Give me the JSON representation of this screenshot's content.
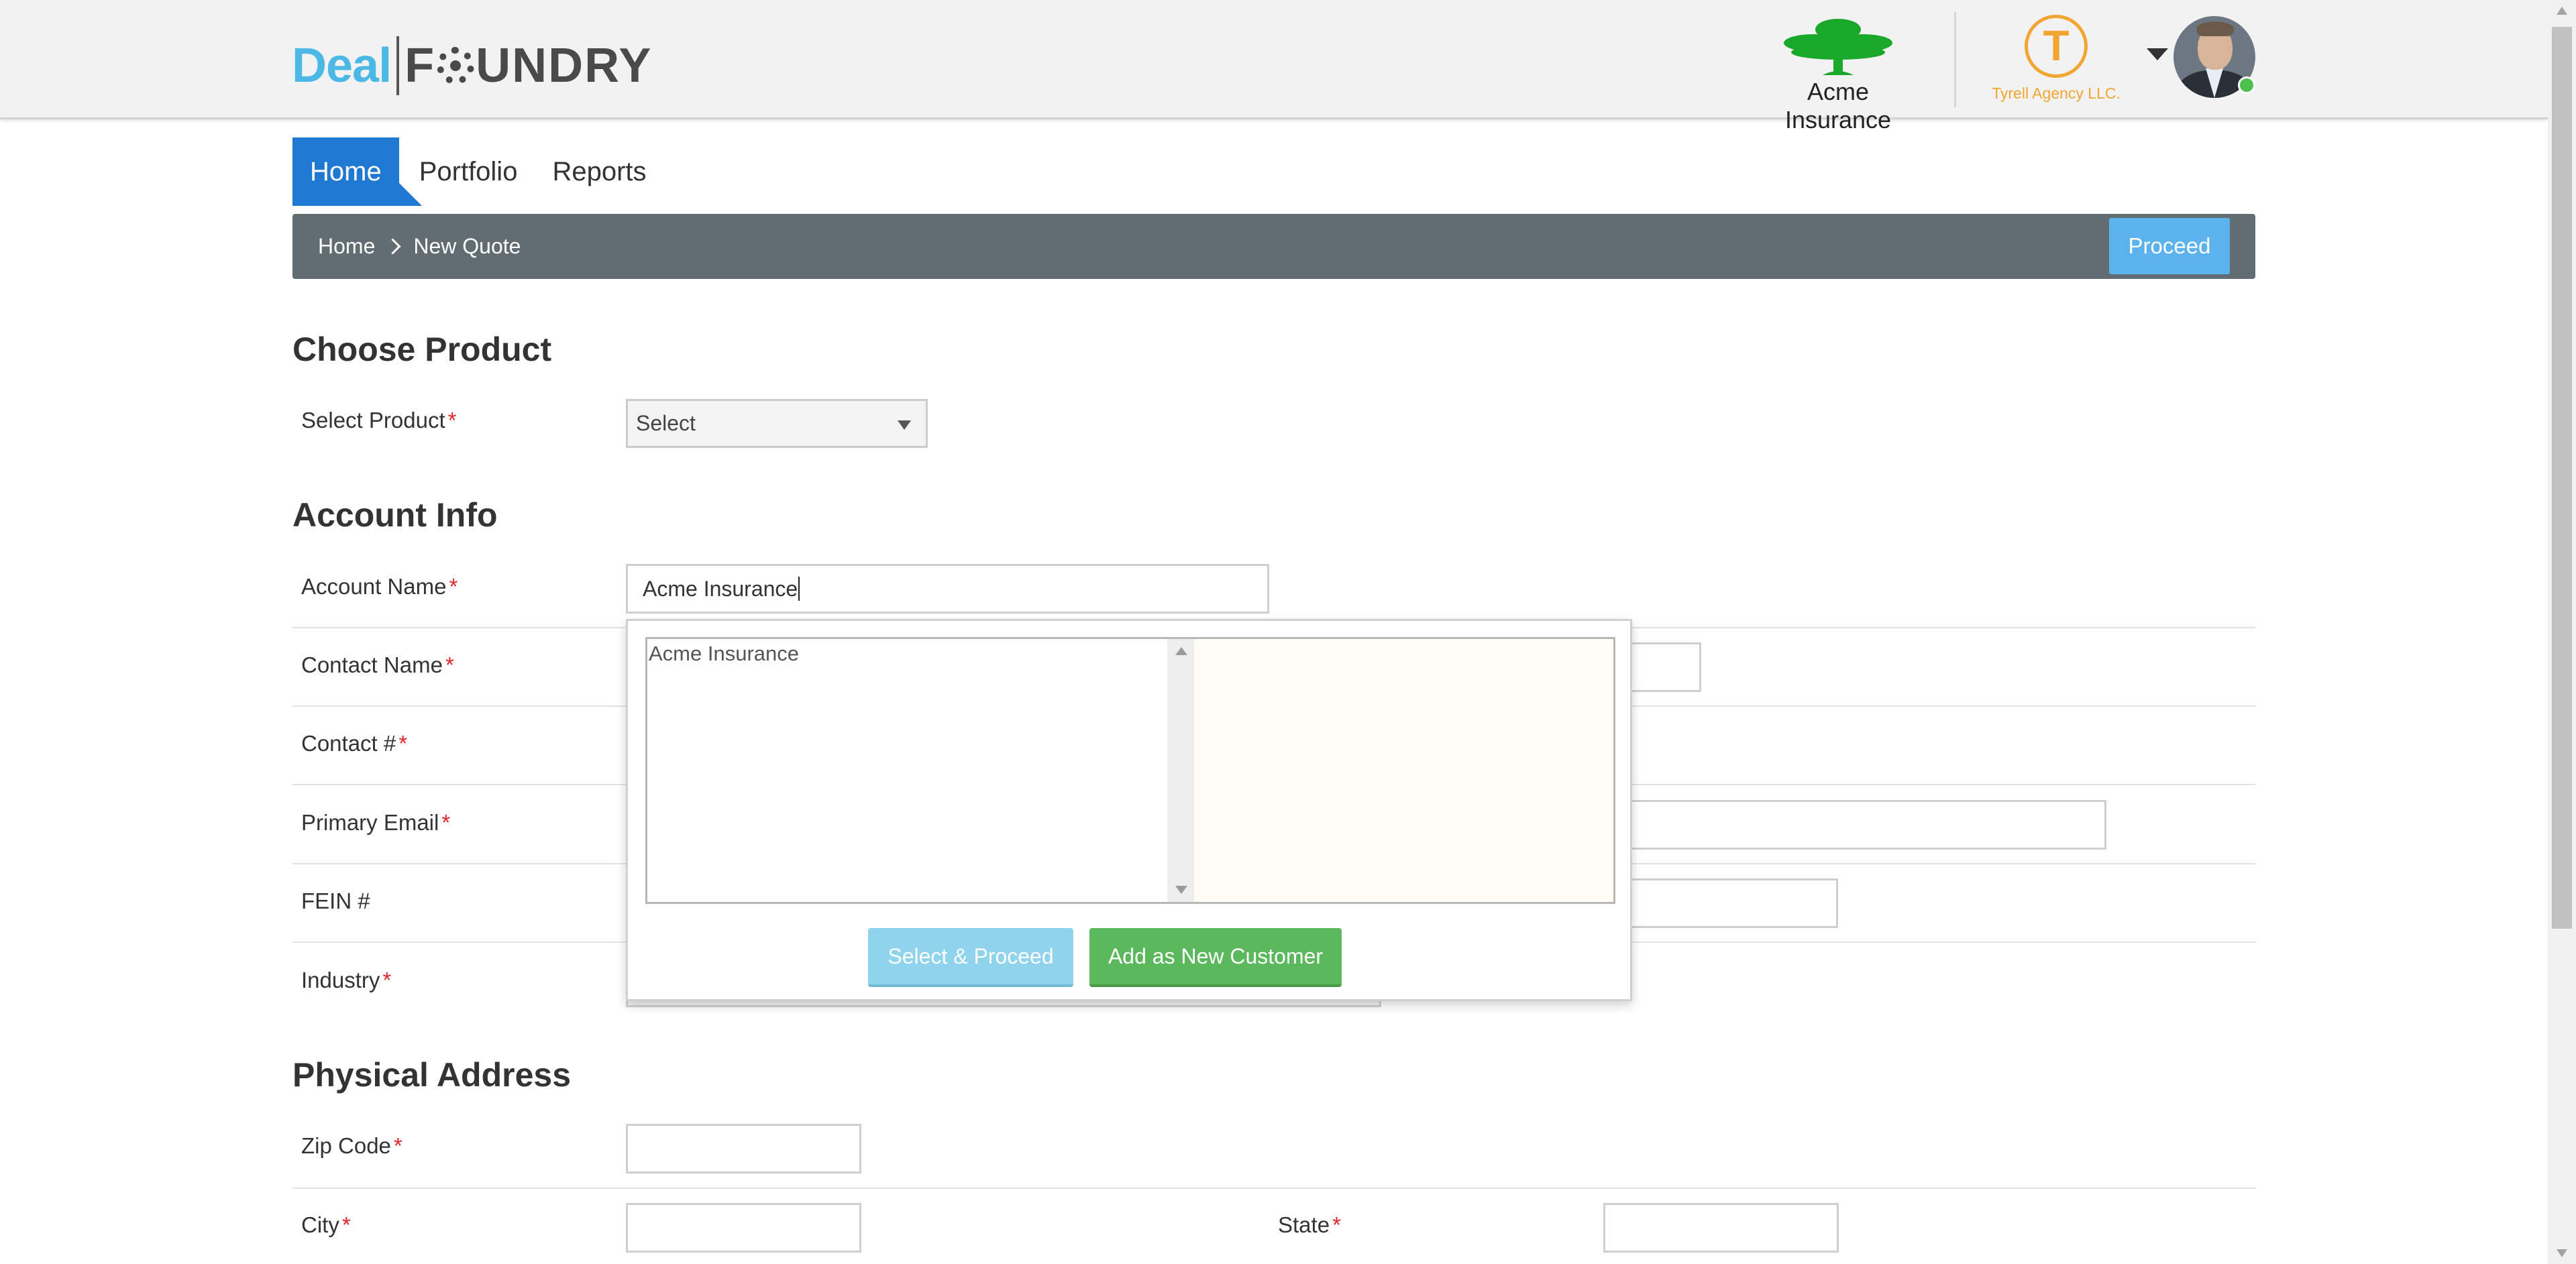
{
  "brand": {
    "logo_left": "Deal",
    "logo_right_prefix": "F",
    "logo_right_suffix": "UNDRY",
    "carrier_name": "Acme Insurance",
    "agency_name": "Tyrell Agency LLC.",
    "agency_initial": "T"
  },
  "nav": {
    "items": [
      {
        "label": "Home"
      },
      {
        "label": "Portfolio"
      },
      {
        "label": "Reports"
      }
    ]
  },
  "breadcrumb": {
    "items": [
      "Home",
      "New Quote"
    ],
    "proceed_label": "Proceed"
  },
  "choose_product": {
    "title": "Choose Product",
    "select_product_label": "Select Product",
    "select_product_value": "Select"
  },
  "account_info": {
    "title": "Account Info",
    "account_name_label": "Account Name",
    "account_name_value": "Acme Insurance",
    "contact_name_label": "Contact Name",
    "contact_number_label": "Contact #",
    "primary_email_label": "Primary Email",
    "fein_label": "FEIN #",
    "industry_label": "Industry"
  },
  "autocomplete": {
    "results": [
      "Acme Insurance"
    ],
    "select_proceed_label": "Select & Proceed",
    "add_customer_label": "Add as New Customer"
  },
  "physical_address": {
    "title": "Physical Address",
    "zip_label": "Zip Code",
    "city_label": "City",
    "state_label": "State"
  },
  "required_marker": "*",
  "colors": {
    "nav_active": "#1f78d1",
    "breadcrumb_bg": "#616c73",
    "proceed_button": "#5bb2ec",
    "required": "#e0262b",
    "add_button": "#5cb85c",
    "select_proceed_button": "#8fd3ec",
    "carrier_green": "#1aa82a",
    "agency_orange": "#f2a531"
  },
  "icons": {
    "carrier_logo": "tree-icon",
    "user_menu": "caret-down-icon",
    "breadcrumb_separator": "chevron-right-icon",
    "select_arrow": "caret-down-icon"
  }
}
